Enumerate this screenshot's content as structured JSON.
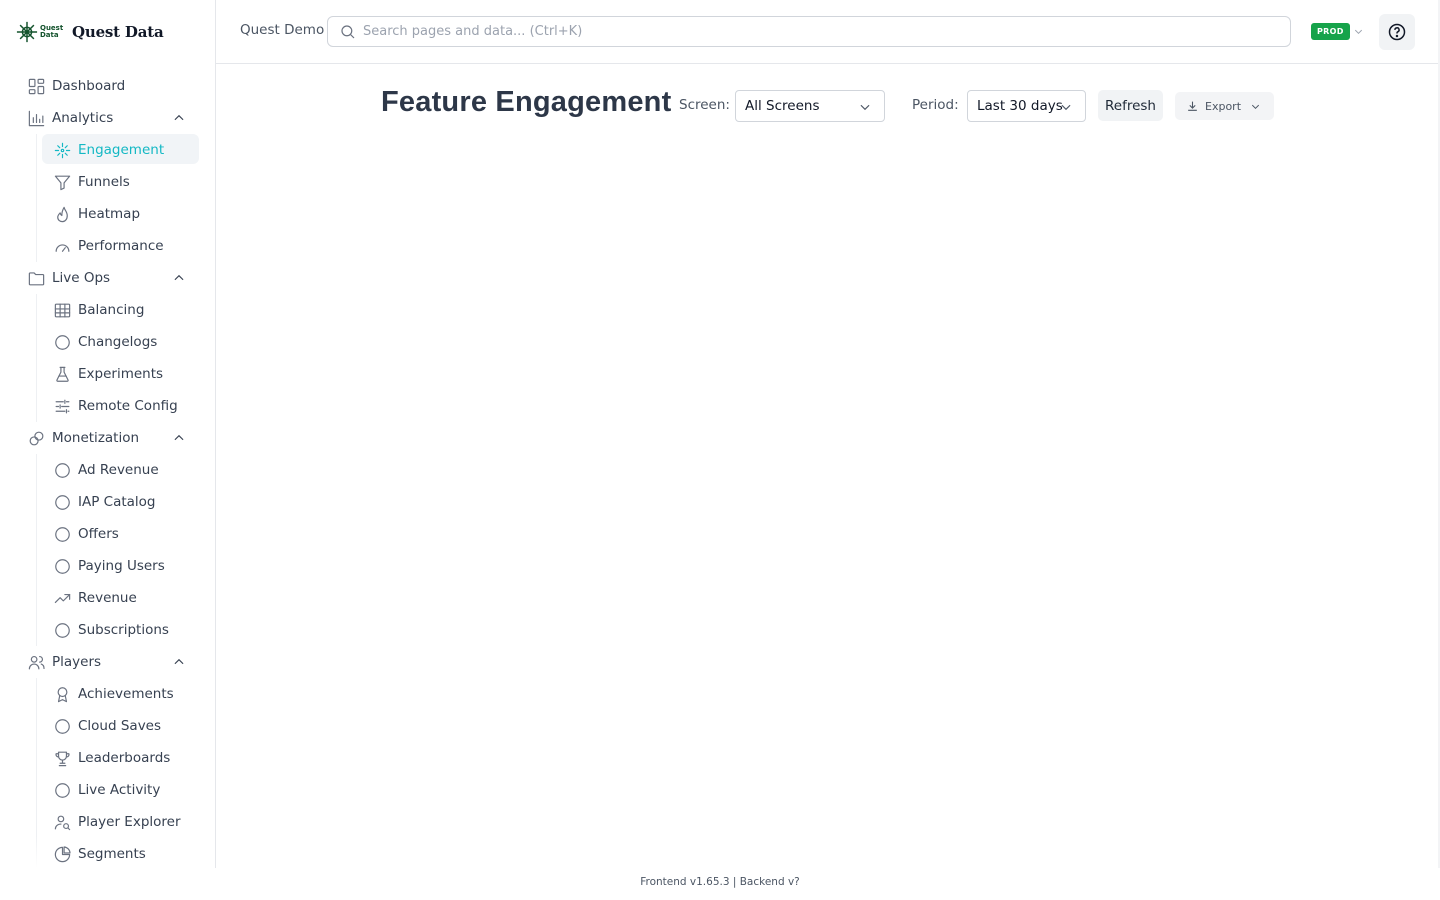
{
  "brand": {
    "small": "Quest Data",
    "title": "Quest Data",
    "color": "#14532d"
  },
  "sidebar": {
    "items": [
      {
        "label": "Dashboard",
        "icon": "grid-icon"
      },
      {
        "label": "Analytics",
        "icon": "bar-chart-icon",
        "expanded": true,
        "children": [
          {
            "label": "Engagement",
            "icon": "sparkle-icon",
            "active": true
          },
          {
            "label": "Funnels",
            "icon": "funnel-icon"
          },
          {
            "label": "Heatmap",
            "icon": "flame-icon"
          },
          {
            "label": "Performance",
            "icon": "gauge-icon"
          }
        ]
      },
      {
        "label": "Live Ops",
        "icon": "folder-icon",
        "expanded": true,
        "children": [
          {
            "label": "Balancing",
            "icon": "table-icon"
          },
          {
            "label": "Changelogs",
            "icon": "circle-icon"
          },
          {
            "label": "Experiments",
            "icon": "flask-icon"
          },
          {
            "label": "Remote Config",
            "icon": "sliders-icon"
          }
        ]
      },
      {
        "label": "Monetization",
        "icon": "coins-icon",
        "expanded": true,
        "children": [
          {
            "label": "Ad Revenue",
            "icon": "circle-icon"
          },
          {
            "label": "IAP Catalog",
            "icon": "circle-icon"
          },
          {
            "label": "Offers",
            "icon": "circle-icon"
          },
          {
            "label": "Paying Users",
            "icon": "circle-icon"
          },
          {
            "label": "Revenue",
            "icon": "trending-up-icon"
          },
          {
            "label": "Subscriptions",
            "icon": "circle-icon"
          }
        ]
      },
      {
        "label": "Players",
        "icon": "users-icon",
        "expanded": true,
        "children": [
          {
            "label": "Achievements",
            "icon": "award-icon"
          },
          {
            "label": "Cloud Saves",
            "icon": "circle-icon"
          },
          {
            "label": "Leaderboards",
            "icon": "trophy-icon"
          },
          {
            "label": "Live Activity",
            "icon": "circle-icon"
          },
          {
            "label": "Player Explorer",
            "icon": "user-search-icon"
          },
          {
            "label": "Segments",
            "icon": "pie-icon"
          }
        ]
      }
    ]
  },
  "topbar": {
    "app_name": "Quest Demo",
    "search_placeholder": "Search pages and data... (Ctrl+K)",
    "env_badge": "PROD",
    "env_color": "#16a34a"
  },
  "page": {
    "title": "Feature Engagement",
    "screen_label": "Screen:",
    "screen_value": "All Screens",
    "period_label": "Period:",
    "period_value": "Last 30 days",
    "refresh_label": "Refresh",
    "export_label": "Export"
  },
  "accent": "#14b8c4",
  "footer": "Frontend v1.65.3 | Backend v?"
}
